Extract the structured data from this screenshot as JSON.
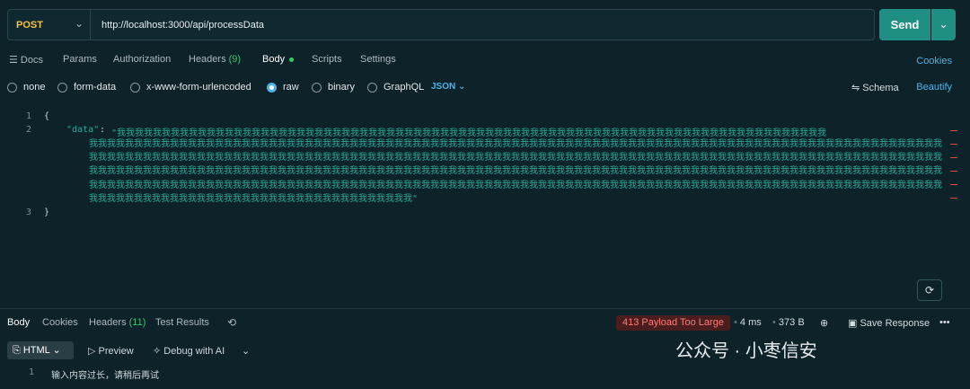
{
  "request": {
    "method": "POST",
    "url": "http://localhost:3000/api/processData",
    "send_label": "Send"
  },
  "request_tabs": {
    "docs": "Docs",
    "params": "Params",
    "authorization": "Authorization",
    "headers": "Headers",
    "headers_count": "(9)",
    "body": "Body",
    "scripts": "Scripts",
    "settings": "Settings",
    "cookies": "Cookies"
  },
  "body_types": {
    "none": "none",
    "form_data": "form-data",
    "urlencoded": "x-www-form-urlencoded",
    "raw": "raw",
    "binary": "binary",
    "graphql": "GraphQL",
    "format": "JSON",
    "schema": "Schema",
    "beautify": "Beautify"
  },
  "editor": {
    "line1": "{",
    "line3": "}",
    "key": "\"data\"",
    "colon": ":",
    "string_open": "\"我我我我我我我我我我我我我我我我我我我我我我我我我我我我我我我我我我我我我我我我我我我我我我我我我我我我我我我我我我我我我我我我我我我我我我我我我我我我我我我",
    "string_body": "我我我我我我我我我我我我我我我我我我我我我我我我我我我我我我我我我我我我我我我我我我我我我我我我我我我我我我我我我我我我我我我我我我我我我我我我我我我我我我我我我我我我我我我我我我我我我我我我我我我我我我我我我我我我我我我我我我我我我我我我我我我我我我我我我我我我我我我我我我我我我我我我我我我我我我我我我我我我我我我我我我我我我我我我我我我我我我我我我我我我我我我我我我我我我我我我我我我我我我我我我我我我我我我我我我我我我我我我我我我我我我我我我我我我我我我我我我我我我我我我我我我我我我我我我我我我我我我我我我我我我我我我我我我我我我我我我我我我我我我我我我我我我我我我我我我我我我我我我我我我我我我我我我我我我我我我我我我我我我我我我我我我我我我我我我我我我我我我我我我我我我我我我我我我我我我我我我我我我我我我我我我我我我我我我我我我我我我我我我我我我我我我我我我我我我我我我我我我我我我我我我我我我我我我我我我我我我我我\""
  },
  "response_tabs": {
    "body": "Body",
    "cookies": "Cookies",
    "headers": "Headers",
    "headers_count": "(11)",
    "test_results": "Test Results"
  },
  "response_meta": {
    "status": "413 Payload Too Large",
    "time": "4 ms",
    "size": "373 B",
    "save_response": "Save Response"
  },
  "response_view": {
    "format": "HTML",
    "preview": "Preview",
    "debug_ai": "Debug with AI",
    "line_number": "1",
    "body_text": "输入内容过长，请稍后再试"
  },
  "watermark": "公众号 · 小枣信安",
  "colors": {
    "background": "#0d2229",
    "send_button": "#1f8f83",
    "method": "#f6c344",
    "link": "#4fb3e8",
    "json_string": "#2ea897",
    "status_error_bg": "#4b1e1e",
    "status_error_text": "#ff7b7b"
  }
}
